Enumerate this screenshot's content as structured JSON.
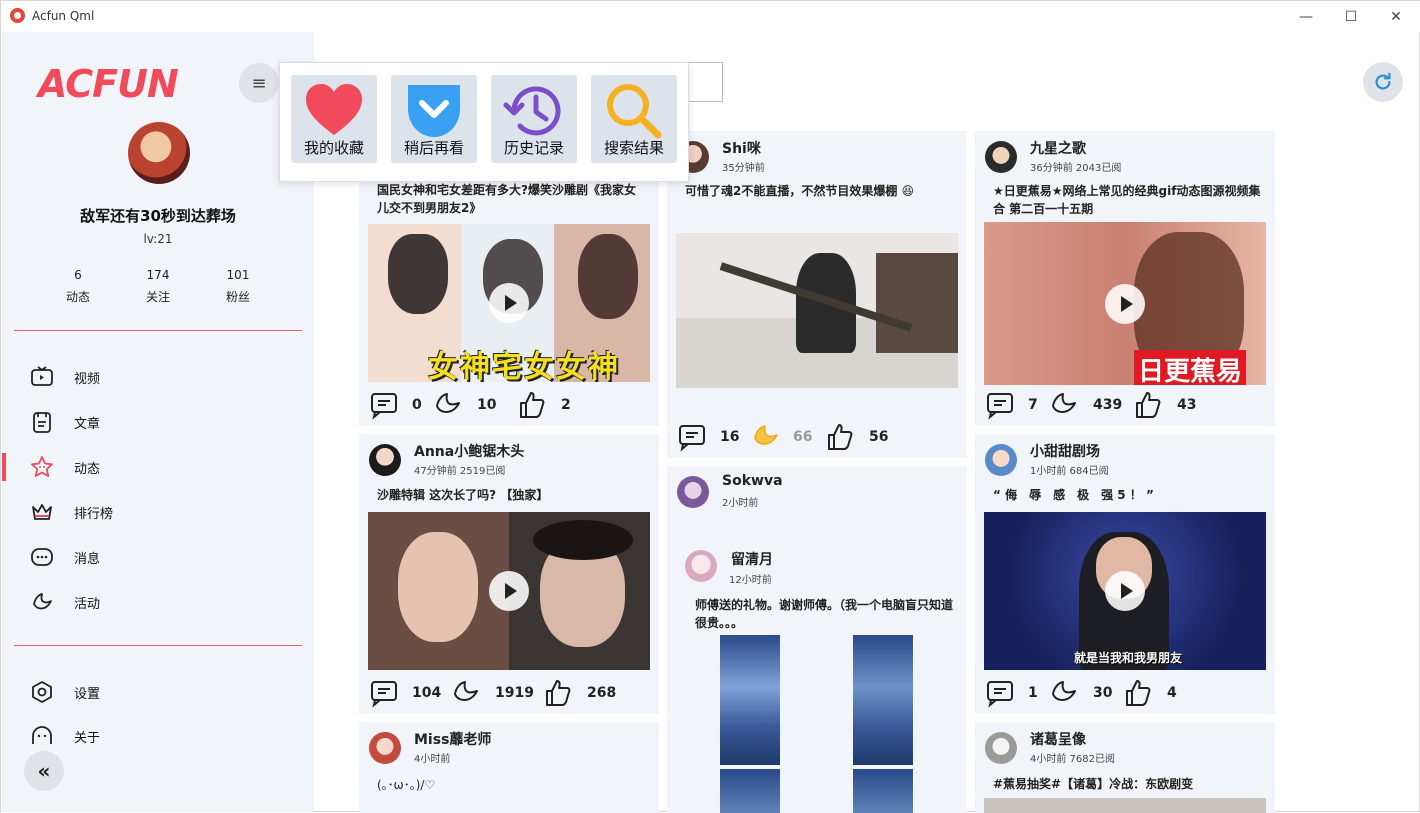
{
  "app": {
    "title": "Acfun Qml"
  },
  "window_controls": {
    "minimize": "—",
    "maximize": "☐",
    "close": "✕"
  },
  "sidebar": {
    "logo": "ACFUN",
    "menu_icon": "≡",
    "user": {
      "name": "敌军还有30秒到达葬场",
      "level": "lv:21"
    },
    "stats": [
      {
        "value": "6",
        "label": "动态"
      },
      {
        "value": "174",
        "label": "关注"
      },
      {
        "value": "101",
        "label": "粉丝"
      }
    ],
    "nav": [
      {
        "label": "视频",
        "icon": "tv-icon"
      },
      {
        "label": "文章",
        "icon": "article-icon"
      },
      {
        "label": "动态",
        "icon": "star-icon",
        "active": true
      },
      {
        "label": "排行榜",
        "icon": "crown-icon"
      },
      {
        "label": "消息",
        "icon": "message-icon"
      },
      {
        "label": "活动",
        "icon": "banana-icon"
      }
    ],
    "bottom_nav": [
      {
        "label": "设置",
        "icon": "settings-icon"
      },
      {
        "label": "关于",
        "icon": "about-icon"
      }
    ],
    "collapse_icon": "«"
  },
  "popup": {
    "items": [
      {
        "label": "我的收藏",
        "icon": "heart-icon"
      },
      {
        "label": "稍后再看",
        "icon": "pocket-icon"
      },
      {
        "label": "历史记录",
        "icon": "history-icon"
      },
      {
        "label": "搜索结果",
        "icon": "search-icon"
      }
    ]
  },
  "feed": {
    "col1": [
      {
        "text": "国民女神和宅女差距有多大?爆笑沙雕剧《我家女儿交不到男朋友2》",
        "overlay": "女神宅女女神",
        "comments": "0",
        "bananas": "10",
        "likes": "2"
      },
      {
        "name": "Anna小鲍锯木头",
        "time": "47分钟前 2519已阅",
        "text": "沙雕特辑 这次长了吗? 【独家】",
        "comments": "104",
        "bananas": "1919",
        "likes": "268"
      },
      {
        "name": "Miss蘼老师",
        "time": "4小时前",
        "text": "(｡･ω･｡)/♡"
      }
    ],
    "col2": [
      {
        "name": "Shi咪",
        "time": "35分钟前",
        "text": "可惜了魂2不能直播，不然节目效果爆棚 😆",
        "comments": "16",
        "bananas": "66",
        "likes": "56"
      },
      {
        "name": "Sokwva",
        "time": "2小时前",
        "repost": {
          "name": "留清月",
          "time": "12小时前",
          "text": "师傅送的礼物。谢谢师傅。（我一个电脑盲只知道很贵。。。"
        }
      }
    ],
    "col3": [
      {
        "name": "九星之歌",
        "time": "36分钟前 2043已阅",
        "text": "★日更蕉易★网络上常见的经典gif动态图源视频集合 第二百一十五期",
        "overlay": "日更蕉易",
        "comments": "7",
        "bananas": "439",
        "likes": "43"
      },
      {
        "name": "小甜甜剧场",
        "time": "1小时前 684已阅",
        "text": "“ 侮　辱　感　极　强 5 ！ ”",
        "overlay": "就是当我和我男朋友",
        "comments": "1",
        "bananas": "30",
        "likes": "4"
      },
      {
        "name": "诸葛呈像",
        "time": "4小时前 7682已阅",
        "text": "#蕉易抽奖#【诸葛】冷战：东欧剧变"
      }
    ]
  },
  "colors": {
    "accent": "#f04a5b",
    "card_bg": "#f1f5fa",
    "sidebar_bg": "#f1f5fa"
  }
}
